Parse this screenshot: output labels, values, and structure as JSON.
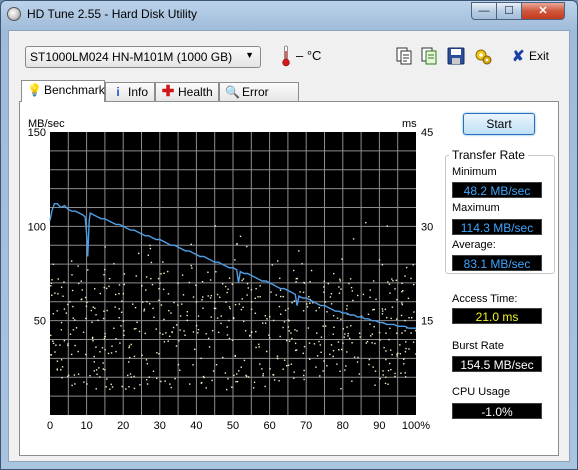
{
  "window": {
    "title": "HD Tune 2.55 - Hard Disk Utility",
    "min_glyph": "—",
    "max_glyph": "☐",
    "close_glyph": "✕"
  },
  "toolbar": {
    "drive": "ST1000LM024 HN-M101M (1000 GB)",
    "temperature": "– °C",
    "icons": [
      "copy-info-icon",
      "copy-text-icon",
      "save-icon",
      "options-icon"
    ],
    "exit_label": "Exit"
  },
  "tabs": [
    {
      "label": "Benchmark",
      "icon": "benchmark-icon",
      "active": true
    },
    {
      "label": "Info",
      "icon": "info-icon",
      "active": false
    },
    {
      "label": "Health",
      "icon": "health-icon",
      "active": false
    },
    {
      "label": "Error Scan",
      "icon": "error-scan-icon",
      "active": false
    }
  ],
  "benchmark": {
    "start_label": "Start",
    "transfer_rate_title": "Transfer Rate",
    "minimum_label": "Minimum",
    "minimum_value": "48.2 MB/sec",
    "maximum_label": "Maximum",
    "maximum_value": "114.3 MB/sec",
    "average_label": "Average:",
    "average_value": "83.1 MB/sec",
    "access_time_label": "Access Time:",
    "access_time_value": "21.0 ms",
    "burst_rate_label": "Burst Rate",
    "burst_rate_value": "154.5 MB/sec",
    "cpu_usage_label": "CPU Usage",
    "cpu_usage_value": "-1.0%"
  },
  "chart_data": {
    "type": "line",
    "ylabel_left": "MB/sec",
    "ylabel_right": "ms",
    "ylim_left": [
      0,
      150
    ],
    "ylim_right": [
      0,
      45
    ],
    "y_ticks_left": [
      50,
      100,
      150
    ],
    "y_ticks_right": [
      15,
      30,
      45
    ],
    "x_ticks": [
      "0",
      "10",
      "20",
      "30",
      "40",
      "50",
      "60",
      "70",
      "80",
      "90",
      "100%"
    ],
    "x_range": [
      0,
      100
    ],
    "grid": true,
    "background": "#000000",
    "line_color": "#4f9ee8",
    "scatter_color": "#f2f2c8",
    "transfer_series": [
      [
        0,
        103
      ],
      [
        0.5,
        108
      ],
      [
        1.2,
        112
      ],
      [
        2,
        112
      ],
      [
        3,
        110
      ],
      [
        4,
        111
      ],
      [
        5,
        109
      ],
      [
        6,
        108
      ],
      [
        7,
        108
      ],
      [
        8,
        107
      ],
      [
        9,
        106
      ],
      [
        9.6,
        105
      ],
      [
        10,
        96
      ],
      [
        10.3,
        84
      ],
      [
        10.7,
        103
      ],
      [
        11,
        107
      ],
      [
        12,
        106
      ],
      [
        13,
        105
      ],
      [
        14,
        104
      ],
      [
        15,
        104
      ],
      [
        16,
        103
      ],
      [
        17,
        102
      ],
      [
        18,
        101
      ],
      [
        19,
        101
      ],
      [
        20,
        100
      ],
      [
        21,
        99
      ],
      [
        22,
        98
      ],
      [
        23,
        98
      ],
      [
        24,
        97
      ],
      [
        25,
        96
      ],
      [
        26,
        95
      ],
      [
        27,
        95
      ],
      [
        28,
        94
      ],
      [
        29,
        93
      ],
      [
        30,
        93
      ],
      [
        31,
        92
      ],
      [
        32,
        91
      ],
      [
        33,
        90
      ],
      [
        34,
        90
      ],
      [
        35,
        89
      ],
      [
        36,
        88
      ],
      [
        37,
        87
      ],
      [
        38,
        87
      ],
      [
        39,
        86
      ],
      [
        40,
        85
      ],
      [
        41,
        84
      ],
      [
        42,
        84
      ],
      [
        43,
        83
      ],
      [
        44,
        82
      ],
      [
        45,
        81
      ],
      [
        46,
        81
      ],
      [
        47,
        80
      ],
      [
        48,
        79
      ],
      [
        49,
        78
      ],
      [
        50,
        78
      ],
      [
        51,
        77
      ],
      [
        51.5,
        70
      ],
      [
        52,
        76
      ],
      [
        53,
        75
      ],
      [
        54,
        75
      ],
      [
        55,
        74
      ],
      [
        56,
        73
      ],
      [
        57,
        72
      ],
      [
        58,
        71
      ],
      [
        59,
        71
      ],
      [
        60,
        70
      ],
      [
        61,
        69
      ],
      [
        62,
        68
      ],
      [
        63,
        67
      ],
      [
        64,
        67
      ],
      [
        65,
        66
      ],
      [
        66,
        65
      ],
      [
        67,
        64
      ],
      [
        67.5,
        58
      ],
      [
        68,
        63
      ],
      [
        69,
        62
      ],
      [
        70,
        62
      ],
      [
        71,
        61
      ],
      [
        72,
        60
      ],
      [
        73,
        59
      ],
      [
        74,
        58
      ],
      [
        75,
        58
      ],
      [
        76,
        57
      ],
      [
        77,
        56
      ],
      [
        78,
        55
      ],
      [
        79,
        55
      ],
      [
        80,
        54
      ],
      [
        81,
        54
      ],
      [
        82,
        53
      ],
      [
        83,
        53
      ],
      [
        84,
        52
      ],
      [
        85,
        52
      ],
      [
        86,
        51
      ],
      [
        87,
        51
      ],
      [
        88,
        50
      ],
      [
        89,
        50
      ],
      [
        90,
        49
      ],
      [
        91,
        49
      ],
      [
        92,
        48
      ],
      [
        93,
        48
      ],
      [
        94,
        48
      ],
      [
        95,
        47
      ],
      [
        96,
        47
      ],
      [
        97,
        47
      ],
      [
        98,
        46
      ],
      [
        99,
        46
      ],
      [
        100,
        46
      ]
    ]
  }
}
